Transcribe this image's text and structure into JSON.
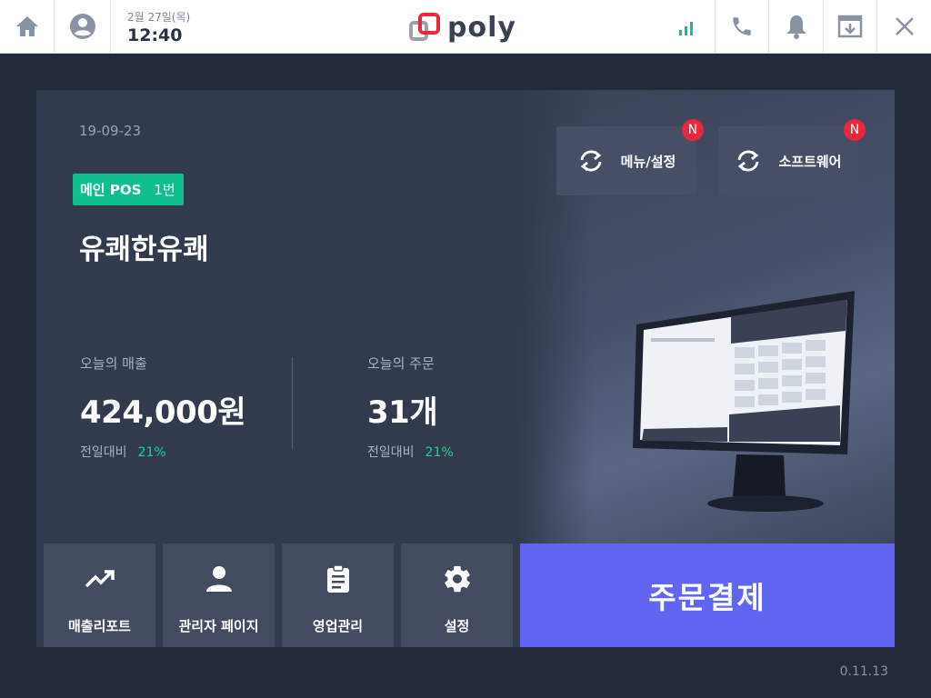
{
  "topbar": {
    "date": "2월 27일(목)",
    "time": "12:40",
    "brand": "poly",
    "colors": {
      "signal": "#0fc08e",
      "icon": "#8a93a3",
      "logo_red": "#e8283c"
    }
  },
  "dashboard": {
    "date": "19-09-23",
    "pos_badge": {
      "label": "메인 POS",
      "number": "1번"
    },
    "store_name": "유쾌한유쾌",
    "sales": {
      "label": "오늘의 매출",
      "value": "424,000원",
      "compare_label": "전일대비",
      "compare_value": "21%"
    },
    "orders": {
      "label": "오늘의 주문",
      "value": "31개",
      "compare_label": "전일대비",
      "compare_value": "21%"
    },
    "sync_buttons": [
      {
        "label": "메뉴/설정",
        "badge": "N"
      },
      {
        "label": "소프트웨어",
        "badge": "N"
      }
    ],
    "bottom_buttons": [
      {
        "label": "매출리포트",
        "icon": "trending-up-icon"
      },
      {
        "label": "관리자 페이지",
        "icon": "person-icon"
      },
      {
        "label": "영업관리",
        "icon": "clipboard-icon"
      },
      {
        "label": "설정",
        "icon": "gear-icon"
      }
    ],
    "pay_button": "주문결제",
    "accent_colors": {
      "badge": "#0fc08e",
      "pay": "#6165f2",
      "new": "#e8283c"
    }
  },
  "version": "0.11.13"
}
